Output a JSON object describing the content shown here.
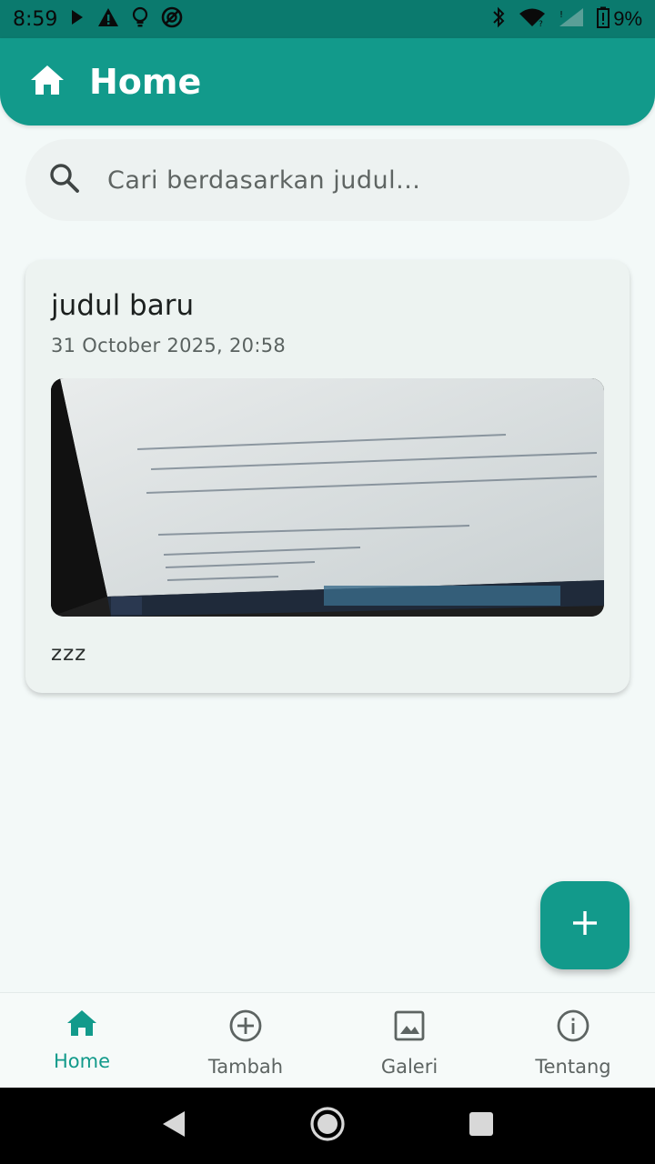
{
  "status_bar": {
    "time": "8:59",
    "battery": "9%"
  },
  "app_bar": {
    "title": "Home"
  },
  "search": {
    "placeholder": "Cari berdasarkan judul..."
  },
  "notes": [
    {
      "title": "judul baru",
      "date": "31 October 2025, 20:58",
      "description": "zzz"
    }
  ],
  "bottom_nav": {
    "items": [
      {
        "label": "Home",
        "icon": "home-icon",
        "active": true
      },
      {
        "label": "Tambah",
        "icon": "add-circle-icon",
        "active": false
      },
      {
        "label": "Galeri",
        "icon": "image-icon",
        "active": false
      },
      {
        "label": "Tentang",
        "icon": "info-icon",
        "active": false
      }
    ]
  },
  "colors": {
    "primary": "#129a8b",
    "status_bar": "#0b7a6e",
    "background": "#f3f9f8",
    "card": "#edf3f1"
  }
}
